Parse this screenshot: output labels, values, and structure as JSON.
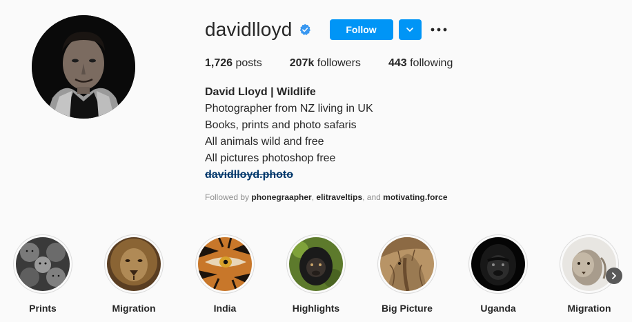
{
  "profile": {
    "username": "davidlloyd",
    "verified_icon": "verified-badge-icon",
    "follow_label": "Follow",
    "accent_color": "#0095f6"
  },
  "stats": {
    "posts_count": "1,726",
    "posts_label": "posts",
    "followers_count": "207k",
    "followers_label": "followers",
    "following_count": "443",
    "following_label": "following"
  },
  "bio": {
    "name": "David Lloyd | Wildlife",
    "lines": [
      "Photographer from NZ living in UK",
      "Books, prints and photo safaris",
      "All animals wild and free",
      "All pictures photoshop free"
    ],
    "link": "davidlloyd.photo"
  },
  "followed_by": {
    "prefix": "Followed by",
    "accounts": [
      "phonegraapher",
      "elitraveltips",
      "motivating.force"
    ],
    "sep1": ",",
    "sep2": ", and"
  },
  "highlights": [
    {
      "label": "Prints"
    },
    {
      "label": "Migration"
    },
    {
      "label": "India"
    },
    {
      "label": "Highlights"
    },
    {
      "label": "Big Picture"
    },
    {
      "label": "Uganda"
    },
    {
      "label": "Migration"
    }
  ]
}
